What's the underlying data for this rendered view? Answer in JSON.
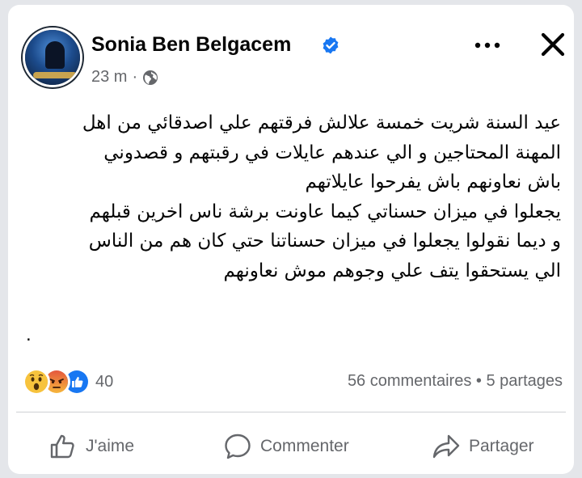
{
  "post": {
    "author": "Sonia Ben Belgacem",
    "verified": true,
    "time": "23 m",
    "separator": "·",
    "audience_icon": "globe-icon",
    "lines": [
      "عيد السنة شريت  خمسة علالش فرقتهم علي اصدقائي من اهل",
      "المهنة المحتاجين و الي عندهم عايلات في رقبتهم و  قصدوني",
      "باش نعاونهم باش يفرحوا عايلاتهم",
      "يجعلوا في ميزان حسناتي  كيما عاونت  برشة ناس اخرين قبلهم",
      "و ديما نقولوا يجعلوا في ميزان حسناتنا حتي كان هم من الناس",
      "الي يستحقوا يتف علي وجوهم موش نعاونهم"
    ],
    "trailing_dot": "."
  },
  "reactions": {
    "icons": [
      "wow-reaction-icon",
      "angry-reaction-icon",
      "like-reaction-icon"
    ],
    "count": "40"
  },
  "stats": {
    "comments": "56 commentaires",
    "dot": "•",
    "shares": "5 partages"
  },
  "actions": {
    "like": "J'aime",
    "comment": "Commenter",
    "share": "Partager"
  },
  "colors": {
    "text": "#050505",
    "secondary": "#65676b",
    "verified_blue": "#1877f2",
    "divider": "#ced0d4"
  }
}
